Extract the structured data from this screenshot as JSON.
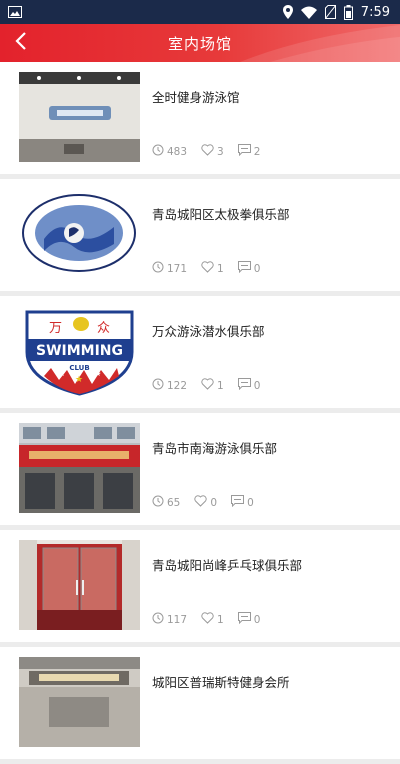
{
  "status_bar": {
    "time": "7:59",
    "icons": [
      "photo-icon",
      "location-icon",
      "wifi-icon",
      "no-sim-icon",
      "battery-icon"
    ]
  },
  "header": {
    "title": "室内场馆",
    "back_icon": "chevron-left-icon",
    "background": "#e3222c"
  },
  "venues": [
    {
      "name": "全时健身游泳馆",
      "views": "483",
      "likes": "3",
      "comments": "2",
      "thumb": "office-lobby"
    },
    {
      "name": "青岛城阳区太极拳俱乐部",
      "views": "171",
      "likes": "1",
      "comments": "0",
      "thumb": "taichi-association-logo"
    },
    {
      "name": "万众游泳潜水俱乐部",
      "views": "122",
      "likes": "1",
      "comments": "0",
      "thumb": "swimming-club-badge",
      "logo_text": {
        "top": "万",
        "top2": "众",
        "main": "SWIMMING",
        "sub": "CLUB"
      }
    },
    {
      "name": "青岛市南海游泳俱乐部",
      "views": "65",
      "likes": "0",
      "comments": "0",
      "thumb": "storefront"
    },
    {
      "name": "青岛城阳尚峰乒乓球俱乐部",
      "views": "117",
      "likes": "1",
      "comments": "0",
      "thumb": "glass-door"
    },
    {
      "name": "城阳区普瑞斯特健身会所",
      "views": "",
      "likes": "",
      "comments": "",
      "thumb": "reception"
    }
  ]
}
